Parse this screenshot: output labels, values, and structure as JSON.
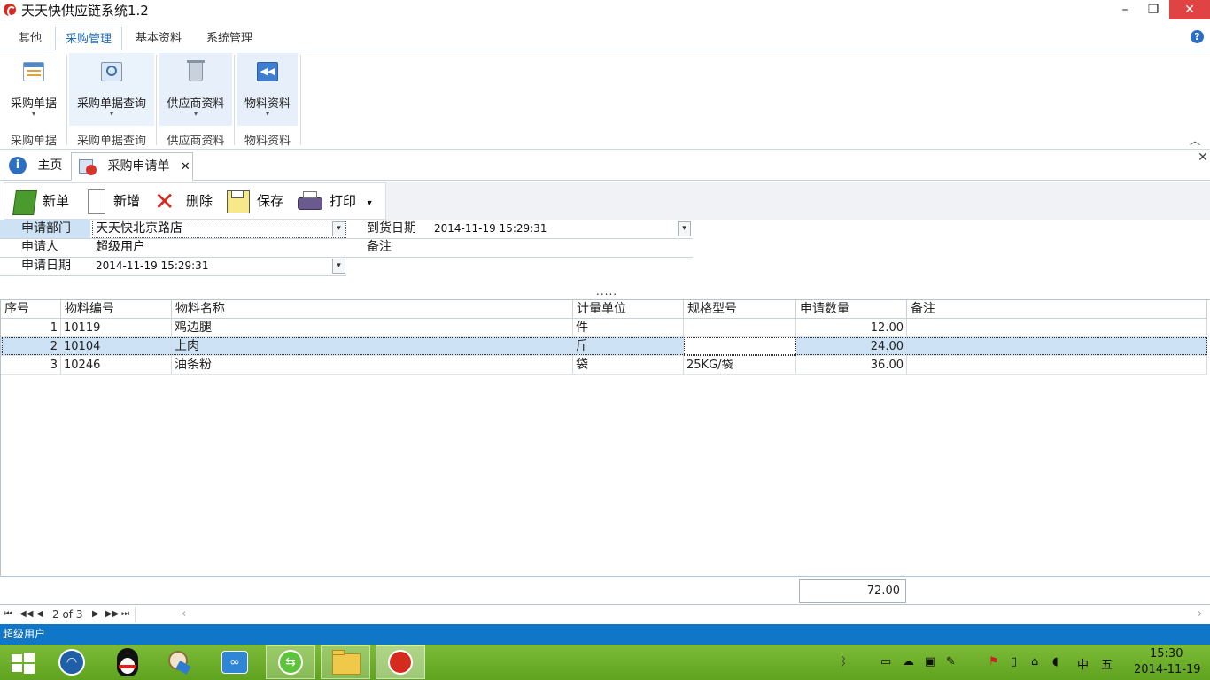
{
  "window": {
    "title": "天天快供应链系统1.2",
    "minimize": "–",
    "restore": "❐",
    "close": "✕"
  },
  "ribbon": {
    "tabs": [
      "其他",
      "采购管理",
      "基本资料",
      "系统管理"
    ],
    "active_tab": "采购管理",
    "groups": [
      {
        "button": "采购单据",
        "group": "采购单据",
        "icon": "calendar-icon"
      },
      {
        "button": "采购单据查询",
        "group": "采购单据查询",
        "icon": "query-icon"
      },
      {
        "button": "供应商资料",
        "group": "供应商资料",
        "icon": "trash-icon"
      },
      {
        "button": "物料资料",
        "group": "物料资料",
        "icon": "rewind-icon"
      }
    ],
    "caret": "▾",
    "help": "?",
    "collapse": "︿"
  },
  "doc_tabs": {
    "home": "主页",
    "form": "采购申请单",
    "close": "✕",
    "close_all": "✕"
  },
  "toolbar": {
    "new_doc": "新单",
    "add": "新增",
    "delete": "删除",
    "save": "保存",
    "print": "打印",
    "print_caret": "▾"
  },
  "form": {
    "dept_label": "申请部门",
    "dept_value": "天天快北京路店",
    "applicant_label": "申请人",
    "applicant_value": "超级用户",
    "apply_date_label": "申请日期",
    "apply_date_value": "2014-11-19 15:29:31",
    "arrival_label": "到货日期",
    "arrival_value": "2014-11-19 15:29:31",
    "remark_label": "备注",
    "remark_value": "",
    "combo_arrow": "▾"
  },
  "grid": {
    "splitter": ".....",
    "columns": [
      "序号",
      "物料编号",
      "物料名称",
      "计量单位",
      "规格型号",
      "申请数量",
      "备注"
    ],
    "rows": [
      {
        "no": "1",
        "code": "10119",
        "name": "鸡边腿",
        "unit": "件",
        "spec": "",
        "qty": "12.00",
        "remark": ""
      },
      {
        "no": "2",
        "code": "10104",
        "name": "上肉",
        "unit": "斤",
        "spec": "",
        "qty": "24.00",
        "remark": ""
      },
      {
        "no": "3",
        "code": "10246",
        "name": "油条粉",
        "unit": "袋",
        "spec": "25KG/袋",
        "qty": "36.00",
        "remark": ""
      }
    ],
    "selected_row": 2,
    "total": "72.00"
  },
  "navigator": {
    "first": "⏮",
    "prev_page": "◀◀",
    "prev": "◀",
    "position": "2 of 3",
    "next": "▶",
    "next_page": "▶▶",
    "last": "⏭",
    "scroll_left": "‹",
    "scroll_right": "›"
  },
  "status": {
    "user": "超级用户"
  },
  "taskbar": {
    "apps": [
      "windows-start",
      "wifi-app",
      "qq-app",
      "tool-app",
      "network-app",
      "browser-app",
      "explorer-app",
      "supply-chain-app"
    ],
    "tray_ime": "中",
    "tray_kbd": "五",
    "time": "15:30",
    "date": "2014-11-19"
  },
  "colors": {
    "accent": "#1e6fbf",
    "status_bar": "#0f76c8",
    "taskbar": "#6aab2a",
    "selected_row": "#cde3f5",
    "close_btn": "#e04343"
  }
}
